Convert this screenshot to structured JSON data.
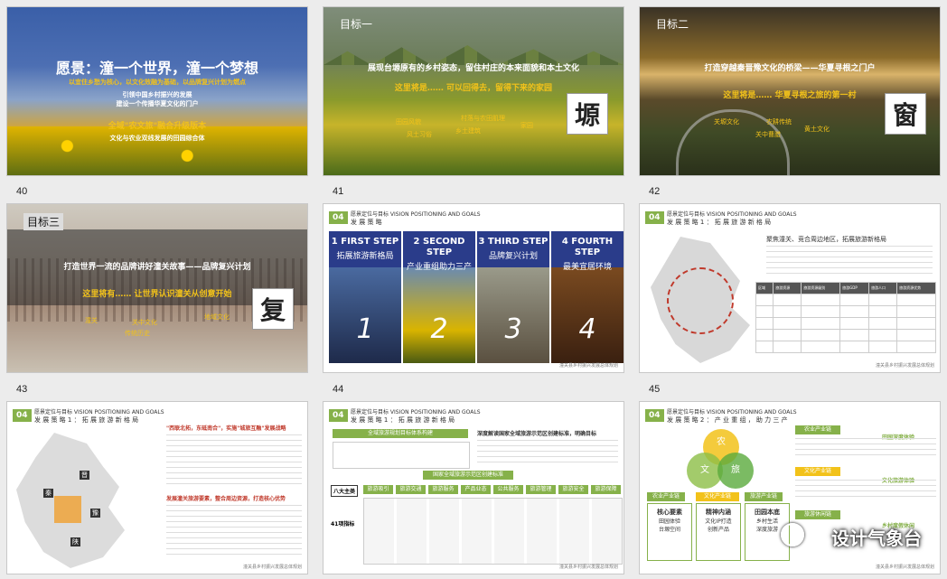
{
  "slides": [
    {
      "number": "40",
      "title": "愿景：潼一个世界，潼一个梦想",
      "line1": "以宜住乡愁为核心，以文化效融为基础，以品牌复兴计划为燃点",
      "line2": "引领中国乡村振兴的发展",
      "line3": "建设一个传播华夏文化的门户",
      "line4": "全域\"农文旅\"融合升级版本",
      "line5": "文化与农业双线发展的田园综合体"
    },
    {
      "number": "41",
      "goal": "目标一",
      "title": "展现台塬原有的乡村姿态，留住村庄的本来面貌和本土文化",
      "sub": "这里将是…… 可以回得去，留得下来的家园",
      "badge": "塬",
      "labels": [
        "田园风貌",
        "村落与农田肌理",
        "风土习俗",
        "乡土建筑",
        "家园"
      ]
    },
    {
      "number": "42",
      "goal": "目标二",
      "title": "打造穿越秦晋豫文化的桥梁——华夏寻根之门户",
      "sub": "这里将是…… 华夏寻根之旅的第一村",
      "badge": "窗",
      "labels": [
        "关塬文化",
        "农耕传统",
        "黄土文化",
        "关中曹腊"
      ]
    },
    {
      "number": "43",
      "goal": "目标三",
      "title": "打造世界一流的品牌讲好潼关故事——品牌复兴计划",
      "sub": "这里将有…… 让世界认识潼关从创意开始",
      "badge": "复",
      "labels": [
        "潼关",
        "关中文化",
        "地域文化",
        "传统历史"
      ]
    },
    {
      "number": "44",
      "section": "04",
      "head_small": "愿景定位与目标 VISION POSITIONING AND GOALS",
      "head": "发 展 策 略",
      "steps": [
        {
          "title": "1 FIRST STEP",
          "sub": "拓展旅游新格局",
          "n": "1"
        },
        {
          "title": "2 SECOND STEP",
          "sub": "产业重组助力三产",
          "n": "2"
        },
        {
          "title": "3 THIRD STEP",
          "sub": "品牌复兴计划",
          "n": "3"
        },
        {
          "title": "4 FOURTH STEP",
          "sub": "最美宜居环境",
          "n": "4"
        }
      ],
      "footer": "潼关县乡村振兴发展总体规划"
    },
    {
      "number": "45",
      "section": "04",
      "head_small": "愿景定位与目标 VISION POSITIONING AND GOALS",
      "head": "发 展 策 略 1 ： 拓 展 旅 游 新 格 局",
      "heading": "聚焦潼关、竞合周边地区，拓展旅游新格局",
      "table_header": [
        "区域",
        "旅游资源",
        "旅游资源级别",
        "旅游GDP",
        "旅游人口",
        "旅游资源优势"
      ],
      "footer": "潼关县乡村振兴发展总体规划"
    },
    {
      "number": "",
      "section": "04",
      "head_small": "愿景定位与目标 VISION POSITIONING AND GOALS",
      "head": "发 展 策 略 1 ： 拓 展 旅 游 新 格 局",
      "heading1": "\"西联北拓，东砥南合\"，实施\"城旅互融\"发展战略",
      "heading2": "发展潼关旅游要素，整合周边资源，打造核心优势",
      "map_labels": [
        "晋",
        "秦",
        "豫",
        "陕"
      ],
      "footer": "潼关县乡村振兴发展总体规划"
    },
    {
      "number": "",
      "section": "04",
      "head_small": "愿景定位与目标 VISION POSITIONING AND GOALS",
      "head": "发 展 策 略 1 ： 拓 展 旅 游 新 格 局",
      "banner1": "全域旅游规划目标体系构建",
      "banner2": "深度解读国家全域旅游示范区创建标准，明确目标",
      "banner3": "国家全域旅游示范区创建标准",
      "six": "八大主类",
      "cats": [
        "旅游吸引",
        "旅游交通",
        "旅游服务",
        "产品业态",
        "公共服务",
        "旅游管理",
        "旅游安全",
        "旅游保障"
      ],
      "left_label": "41项指标",
      "footer": "潼关县乡村振兴发展总体规划"
    },
    {
      "number": "",
      "section": "04",
      "head_small": "愿景定位与目标 VISION POSITIONING AND GOALS",
      "head": "发 展 策 略 2 ： 产 业 重 组 ， 助 力 三 产",
      "venn": [
        "农",
        "文",
        "旅"
      ],
      "boxes": [
        {
          "tag": "农业产业链",
          "title": "核心要素",
          "sub": "田园体验\n台塬空间"
        },
        {
          "tag": "文化产业链",
          "title": "精神内涵",
          "sub": "文化IP打造\n创新产品"
        },
        {
          "tag": "旅游产业链",
          "title": "田园本底",
          "sub": "乡村生活\n深度旅游"
        }
      ],
      "right_tags": [
        "农业产业链",
        "田园深度体验",
        "文化产业链",
        "文化旅游体验",
        "旅游休闲链",
        "乡村度假休闲"
      ],
      "watermark": "设计气象台",
      "footer": "潼关县乡村振兴发展总体规划"
    }
  ]
}
